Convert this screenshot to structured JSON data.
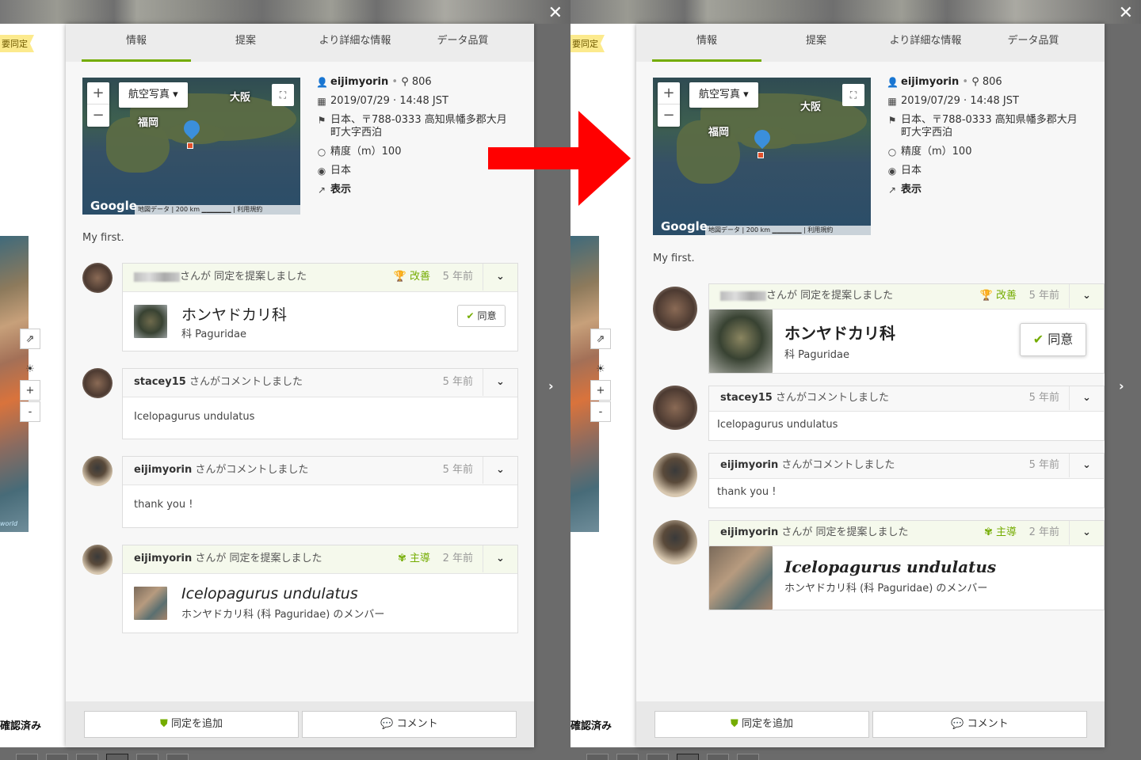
{
  "left": {
    "close": "✕",
    "badge": "要同定",
    "confirmed": "確認済み",
    "bg_controls": {
      "share": "⇗",
      "brightness": "☀",
      "zoom_in": "+",
      "zoom_out": "-"
    },
    "watermark": "world",
    "tabs": [
      "情報",
      "提案",
      "より詳細な情報",
      "データ品質"
    ],
    "map": {
      "map_type": "航空写真 ▾",
      "zoom_in": "+",
      "zoom_out": "−",
      "fullscreen": "⛶",
      "label_osaka": "大阪",
      "label_fukuoka": "福岡",
      "google": "Google",
      "attribution": "地図データ | 200 km ▁▁▁▁▁▁ | 利用規約"
    },
    "meta": {
      "user": "eijimyorin",
      "user_dot": "•",
      "obs_count": "806",
      "date": "2019/07/29 · 14:48 JST",
      "place_line1": "日本、〒788-0333 高知県幡多郡大月",
      "place_line2": "町大字西泊",
      "accuracy": "精度（m）100",
      "country": "日本",
      "view": "表示"
    },
    "description": "My first.",
    "activity": [
      {
        "type": "ident",
        "action": "さんが 同定を提案しました",
        "category": "改善",
        "time": "5 年前",
        "taxon": "ホンヤドカリ科",
        "taxon_sub": "科 Paguridae",
        "agree": "同意"
      },
      {
        "type": "comment",
        "user": "stacey15",
        "action": "さんがコメントしました",
        "time": "5 年前",
        "body": "Icelopagurus undulatus"
      },
      {
        "type": "comment",
        "user": "eijimyorin",
        "action": "さんがコメントしました",
        "time": "5 年前",
        "body": "thank you !"
      },
      {
        "type": "ident",
        "user": "eijimyorin",
        "action": "さんが 同定を提案しました",
        "category": "主導",
        "time": "2 年前",
        "taxon": "Icelopagurus undulatus",
        "taxon_sub": "ホンヤドカリ科 (科 Paguridae) のメンバー"
      }
    ],
    "footer": {
      "add_id": "同定を追加",
      "comment": "コメント"
    },
    "next": "›"
  },
  "right": {
    "close": "✕",
    "badge": "要同定",
    "confirmed": "確認済み",
    "bg_controls": {
      "share": "⇗",
      "brightness": "☀",
      "zoom_in": "+",
      "zoom_out": "-"
    },
    "tabs": [
      "情報",
      "提案",
      "より詳細な情報",
      "データ品質"
    ],
    "map": {
      "map_type": "航空写真 ▾",
      "zoom_in": "+",
      "zoom_out": "−",
      "fullscreen": "⛶",
      "label_osaka": "大阪",
      "label_fukuoka": "福岡",
      "google": "Google",
      "attribution": "地図データ | 200 km ▁▁▁▁▁▁ | 利用規約"
    },
    "meta": {
      "user": "eijimyorin",
      "user_dot": "•",
      "obs_count": "806",
      "date": "2019/07/29 · 14:48 JST",
      "place_line1": "日本、〒788-0333 高知県幡多郡大月",
      "place_line2": "町大字西泊",
      "accuracy": "精度（m）100",
      "country": "日本",
      "view": "表示"
    },
    "description": "My first.",
    "activity": [
      {
        "type": "ident",
        "action": "さんが 同定を提案しました",
        "category": "改善",
        "time": "5 年前",
        "taxon": "ホンヤドカリ科",
        "taxon_sub": "科 Paguridae",
        "agree": "同意"
      },
      {
        "type": "comment",
        "user": "stacey15",
        "action": "さんがコメントしました",
        "time": "5 年前",
        "body": "Icelopagurus undulatus"
      },
      {
        "type": "comment",
        "user": "eijimyorin",
        "action": "さんがコメントしました",
        "time": "5 年前",
        "body": "thank you !"
      },
      {
        "type": "ident",
        "user": "eijimyorin",
        "action": "さんが 同定を提案しました",
        "category": "主導",
        "time": "2 年前",
        "taxon": "Icelopagurus undulatus",
        "taxon_sub": "ホンヤドカリ科 (科 Paguridae) のメンバー"
      }
    ],
    "footer": {
      "add_id": "同定を追加",
      "comment": "コメント"
    },
    "next": "›"
  },
  "colors": {
    "accent": "#74ac00",
    "pin": "#3b8fdc",
    "arrow": "#ff0000"
  },
  "icons": {
    "user": "user-icon",
    "binoculars": "binoculars-icon",
    "calendar": "calendar-icon",
    "location": "map-marker-icon",
    "accuracy": "circle-icon",
    "globe": "globe-icon",
    "external": "external-link-icon",
    "trophy": "trophy-icon",
    "leading": "leading-icon",
    "check": "check-icon",
    "chevron": "chevron-down-icon",
    "shield": "shield-icon",
    "comment": "comment-icon"
  }
}
